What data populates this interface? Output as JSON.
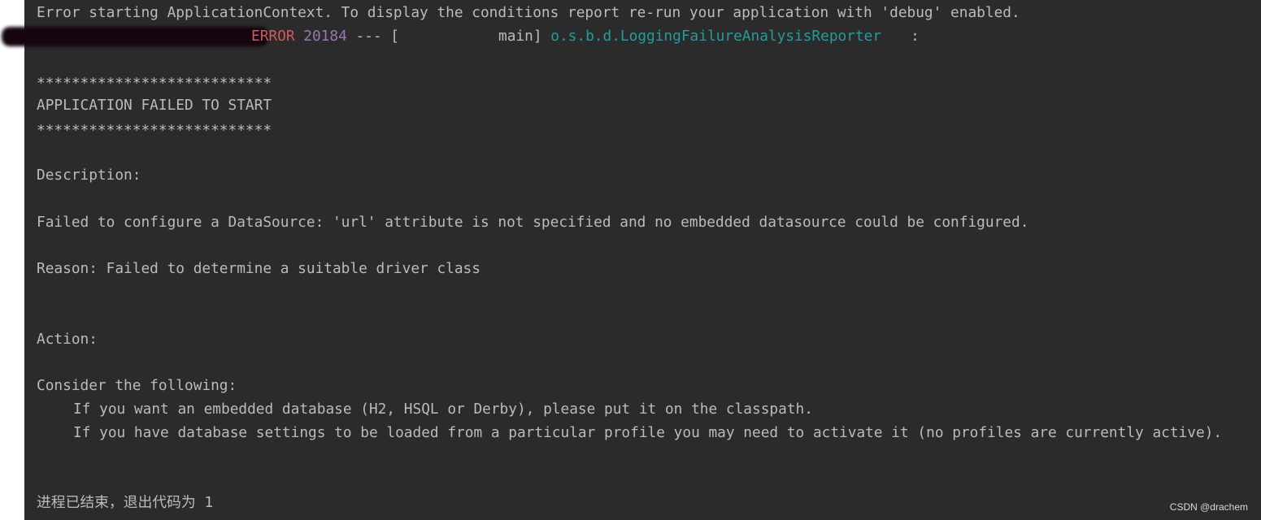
{
  "console": {
    "header": "Error starting ApplicationContext. To display the conditions report re-run your application with 'debug' enabled.",
    "log": {
      "level": "ERROR",
      "pid": "20184",
      "separator": " --- [",
      "thread": "main]",
      "logger": "o.s.b.d.LoggingFailureAnalysisReporter",
      "colon": ":"
    },
    "stars_top": "***************************",
    "failed_title": "APPLICATION FAILED TO START",
    "stars_bottom": "***************************",
    "description_label": "Description:",
    "description_text": "Failed to configure a DataSource: 'url' attribute is not specified and no embedded datasource could be configured.",
    "reason_text": "Reason: Failed to determine a suitable driver class",
    "action_label": "Action:",
    "consider_text": "Consider the following:",
    "suggestion_1": "If you want an embedded database (H2, HSQL or Derby), please put it on the classpath.",
    "suggestion_2": "If you have database settings to be loaded from a particular profile you may need to activate it (no profiles are currently active).",
    "exit_label": "进程已结束，退出代码为",
    "exit_code": "1"
  },
  "watermark": "CSDN @drachem",
  "colors": {
    "background": "#2b2b2b",
    "text": "#bbbbbb",
    "error": "#cc5b5b",
    "pid": "#9b77b2",
    "logger": "#269b9b"
  }
}
